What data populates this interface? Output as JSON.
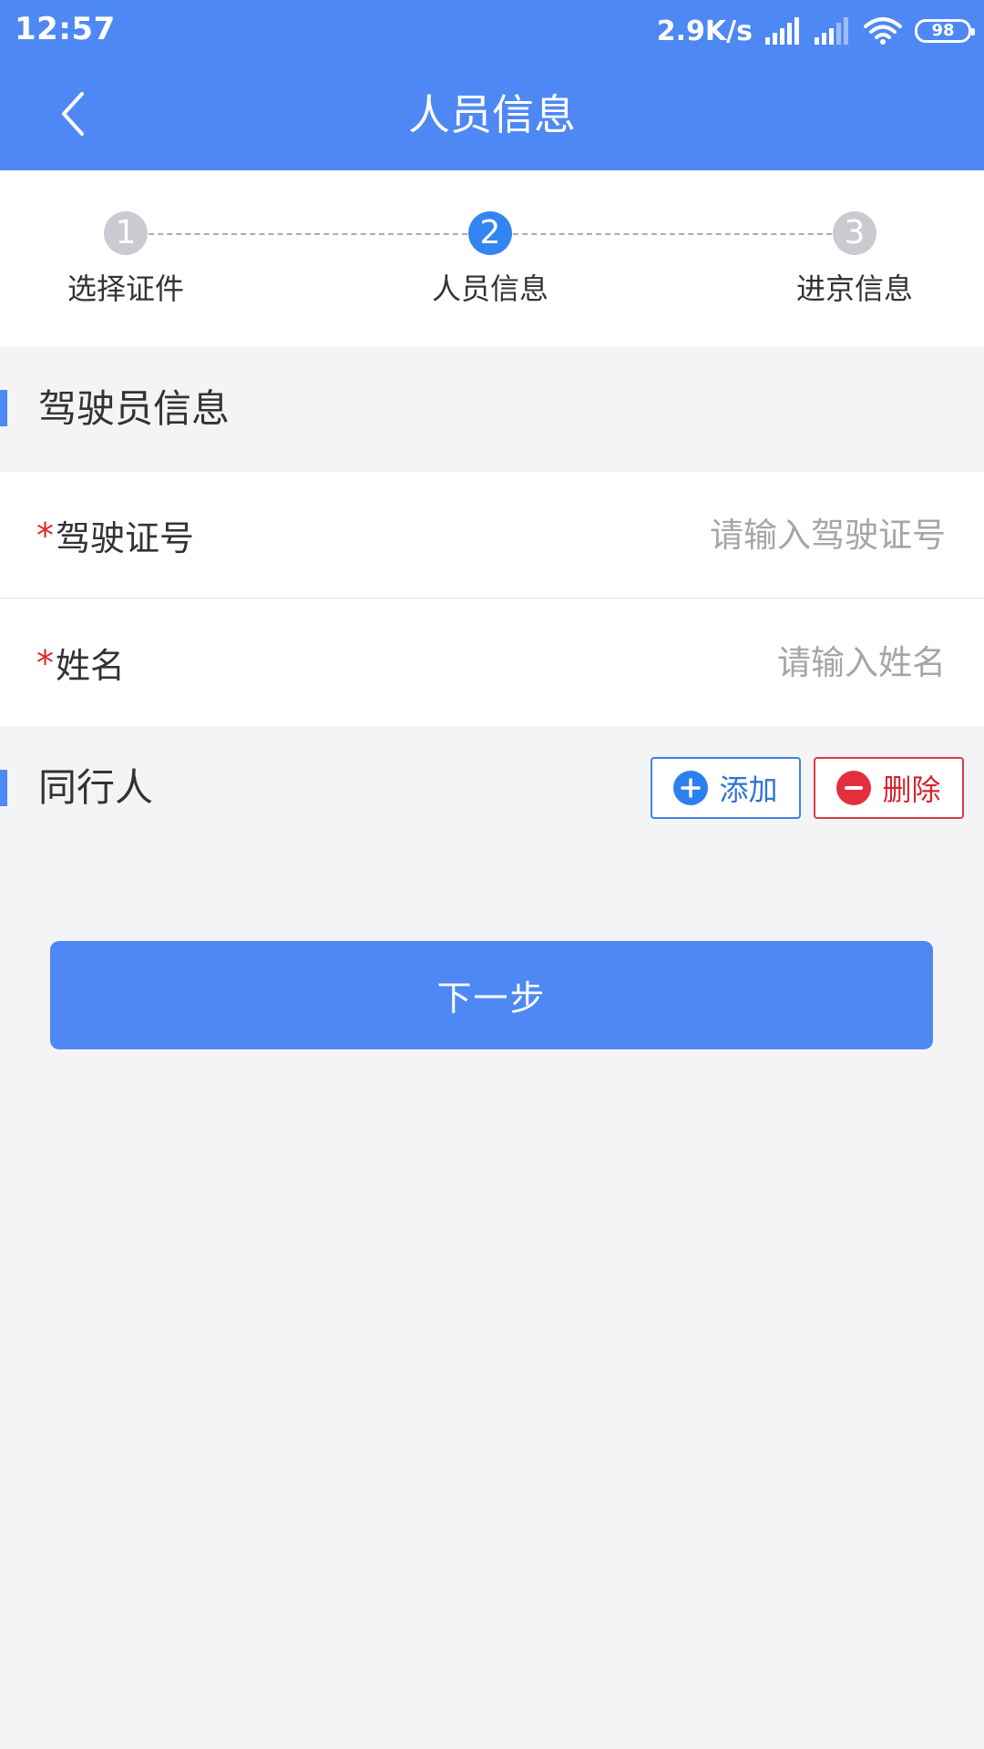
{
  "status_bar": {
    "time": "12:57",
    "net_speed": "2.9K/s",
    "battery": "98"
  },
  "app_bar": {
    "title": "人员信息"
  },
  "stepper": {
    "steps": [
      {
        "number": "1",
        "label": "选择证件",
        "state": "done"
      },
      {
        "number": "2",
        "label": "人员信息",
        "state": "active"
      },
      {
        "number": "3",
        "label": "进京信息",
        "state": "pending"
      }
    ]
  },
  "driver_section": {
    "title": "驾驶员信息",
    "fields": [
      {
        "required_mark": "*",
        "label": "驾驶证号",
        "value": "",
        "placeholder": "请输入驾驶证号"
      },
      {
        "required_mark": "*",
        "label": "姓名",
        "value": "",
        "placeholder": "请输入姓名"
      }
    ]
  },
  "companion_section": {
    "title": "同行人",
    "add_label": "添加",
    "delete_label": "删除"
  },
  "next_button": {
    "label": "下一步"
  },
  "colors": {
    "primary": "#4e88f4",
    "step_active": "#3385f1",
    "step_inactive": "#c9cbd0",
    "required": "#e02727",
    "danger": "#d3262f"
  }
}
